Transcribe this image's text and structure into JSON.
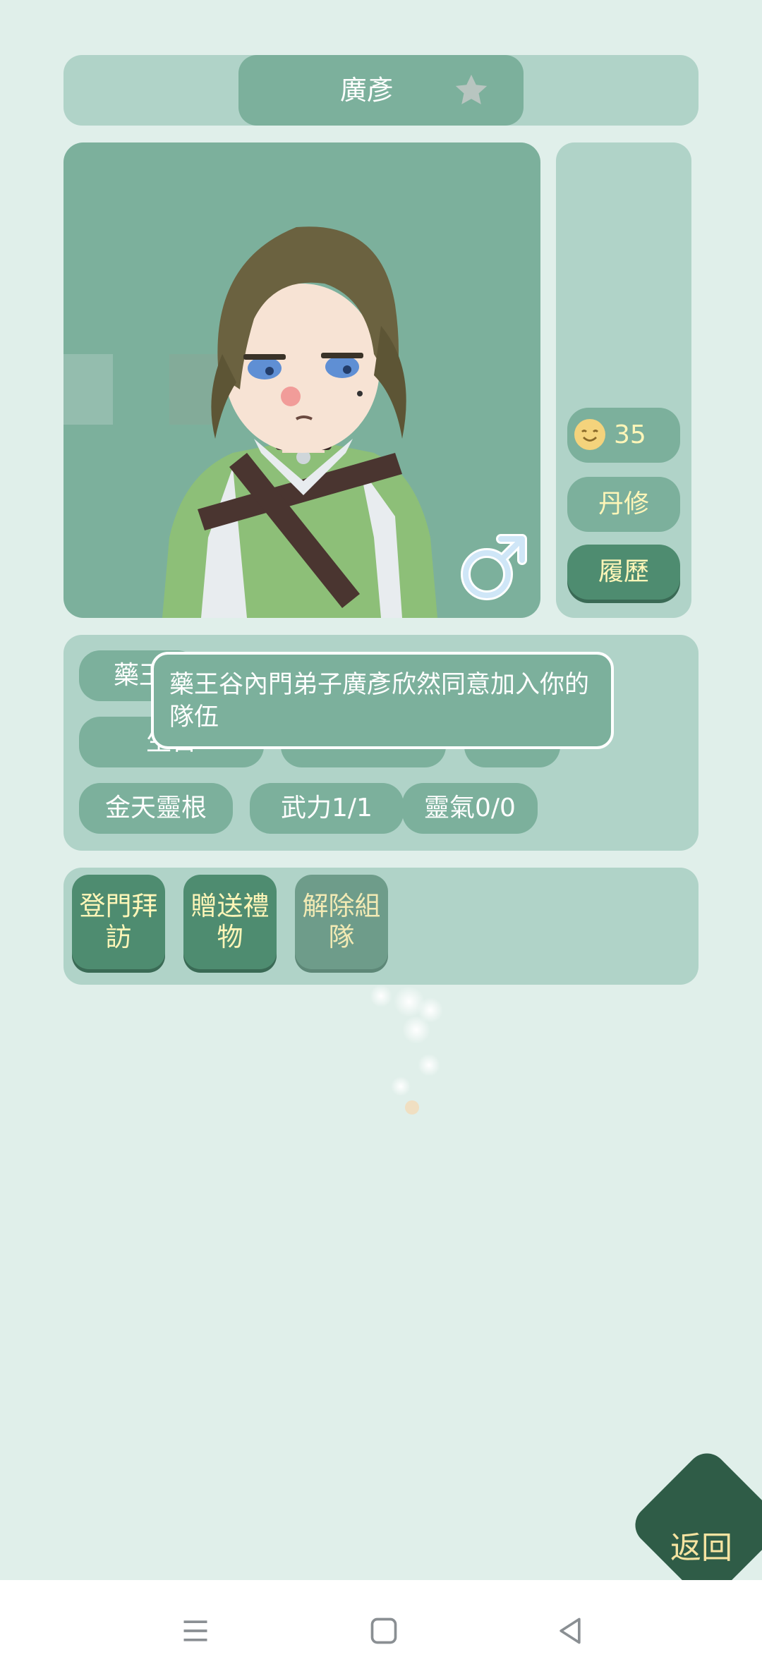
{
  "header": {
    "name": "廣彥",
    "favorite_icon": "star-icon"
  },
  "side": {
    "mood_icon": "smile-face-icon",
    "mood_value": "35",
    "role": "丹修",
    "history": "履歷"
  },
  "portrait": {
    "gender_symbol": "♂",
    "gender": "male"
  },
  "tags": {
    "row1": [
      "藥王"
    ],
    "row2": [
      "生日",
      "",
      ""
    ],
    "row3": [
      "金天靈根",
      "武力1/1",
      "靈氣0/0"
    ]
  },
  "tooltip": {
    "message": "藥王谷內門弟子廣彥欣然同意加入你的隊伍"
  },
  "actions": {
    "visit": "登門拜訪",
    "gift": "贈送禮物",
    "disband": "解除組隊"
  },
  "back": {
    "label": "返回"
  },
  "nav": {
    "menu_icon": "menu-icon",
    "home_icon": "home-icon",
    "back_icon": "back-triangle-icon"
  },
  "colors": {
    "background": "#e0efea",
    "panel": "#b0d3c8",
    "accent": "#7cb09c",
    "button": "#4e8c70",
    "button_text": "#fff6b8",
    "back_button": "#2f5c47"
  }
}
